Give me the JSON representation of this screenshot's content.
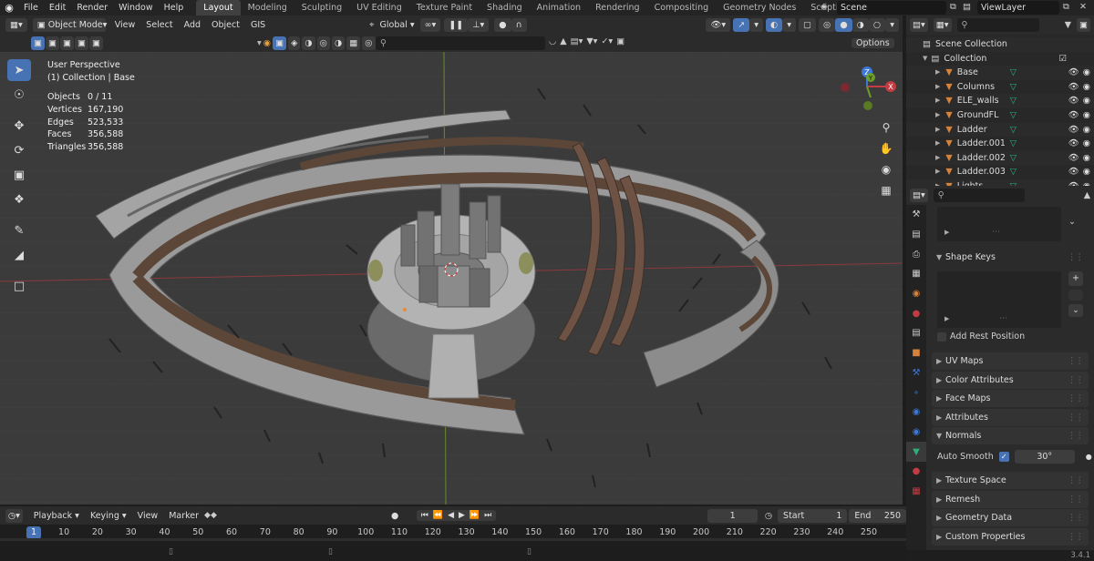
{
  "menu": {
    "items": [
      "File",
      "Edit",
      "Render",
      "Window",
      "Help"
    ]
  },
  "workspaces": {
    "tabs": [
      "Layout",
      "Modeling",
      "Sculpting",
      "UV Editing",
      "Texture Paint",
      "Shading",
      "Animation",
      "Rendering",
      "Compositing",
      "Geometry Nodes",
      "Scripting"
    ],
    "active": "Layout",
    "add": "+"
  },
  "scene": {
    "name": "Scene"
  },
  "view_layer": {
    "name": "ViewLayer"
  },
  "viewport_header": {
    "mode": "Object Mode",
    "menus": [
      "View",
      "Select",
      "Add",
      "Object",
      "GIS"
    ],
    "orientation": "Global",
    "options": "Options"
  },
  "overlay_text": {
    "perspective": "User Perspective",
    "collection": "(1) Collection | Base"
  },
  "stats": [
    {
      "label": "Objects",
      "value": "0 / 11"
    },
    {
      "label": "Vertices",
      "value": "167,190"
    },
    {
      "label": "Edges",
      "value": "523,533"
    },
    {
      "label": "Faces",
      "value": "356,588"
    },
    {
      "label": "Triangles",
      "value": "356,588"
    }
  ],
  "gizmo": {
    "z": "Z",
    "y": "Y",
    "x": "X"
  },
  "outliner": {
    "scene_collection": "Scene Collection",
    "collection": "Collection",
    "objects": [
      "Base",
      "Columns",
      "ELE_walls",
      "GroundFL",
      "Ladder",
      "Ladder.001",
      "Ladder.002",
      "Ladder.003",
      "Lights"
    ]
  },
  "properties": {
    "panels": {
      "shape_keys": "Shape Keys",
      "add_rest_position": "Add Rest Position",
      "uv_maps": "UV Maps",
      "color_attributes": "Color Attributes",
      "face_maps": "Face Maps",
      "attributes": "Attributes",
      "normals": "Normals",
      "auto_smooth": "Auto Smooth",
      "auto_smooth_angle": "30°",
      "texture_space": "Texture Space",
      "remesh": "Remesh",
      "geometry_data": "Geometry Data",
      "custom_properties": "Custom Properties"
    }
  },
  "timeline": {
    "menus": [
      "Playback",
      "Keying",
      "View",
      "Marker"
    ],
    "current_frame": "1",
    "start_label": "Start",
    "start": "1",
    "end_label": "End",
    "end": "250",
    "ruler": [
      "1",
      "10",
      "20",
      "30",
      "40",
      "50",
      "60",
      "70",
      "80",
      "90",
      "100",
      "110",
      "120",
      "130",
      "140",
      "150",
      "160",
      "170",
      "180",
      "190",
      "200",
      "210",
      "220",
      "230",
      "240",
      "250"
    ]
  },
  "version": "3.4.1",
  "colors": {
    "accent": "#4772b3",
    "x_axis": "#c33b43",
    "y_axis": "#6d9e2b",
    "z_axis": "#3c78d8",
    "mesh_green": "#2fae7a",
    "mesh_orange": "#d7823a"
  }
}
